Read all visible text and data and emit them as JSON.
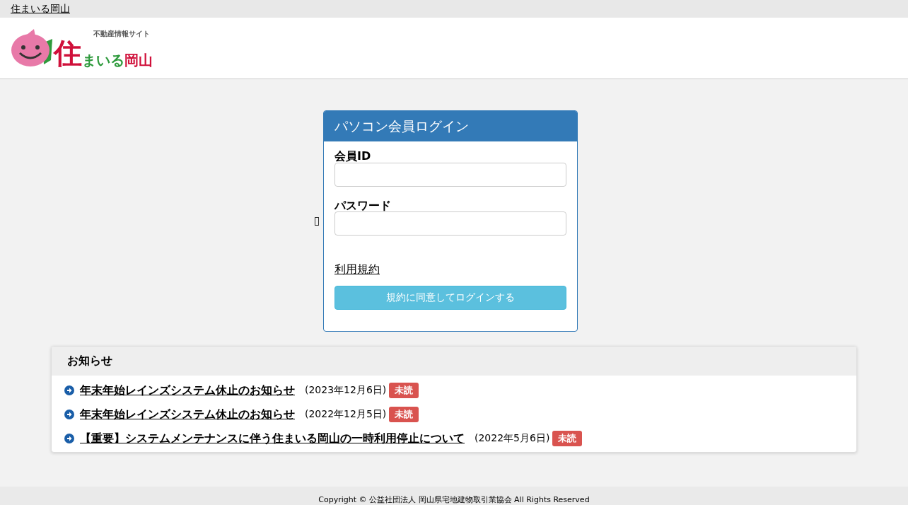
{
  "top_bar": {
    "site_link": "住まいる岡山"
  },
  "logo": {
    "tagline": "不動産情報サイト",
    "name_first": "住",
    "name_middle": "まいる",
    "name_last": "岡山"
  },
  "login": {
    "title": "パソコン会員ログイン",
    "fields": [
      {
        "label": "会員ID"
      },
      {
        "label": "パスワード"
      }
    ],
    "terms_link": "利用規約",
    "submit": "規約に同意してログインする"
  },
  "news": {
    "title": "お知らせ",
    "items": [
      {
        "title": "年末年始レインズシステム休止のお知らせ",
        "date": "(2023年12月6日)",
        "badge": "未読",
        "unread": true
      },
      {
        "title": "年末年始レインズシステム休止のお知らせ",
        "date": "(2022年12月5日)",
        "badge": "未読",
        "unread": true
      },
      {
        "title": "【重要】システムメンテナンスに伴う住まいる岡山の一時利用停止について",
        "date": "(2022年5月6日)",
        "badge": "未読",
        "unread": true
      }
    ]
  },
  "footer": {
    "copyright": "Copyright © 公益社団法人 岡山県宅地建物取引業協会 All Rights Reserved"
  }
}
